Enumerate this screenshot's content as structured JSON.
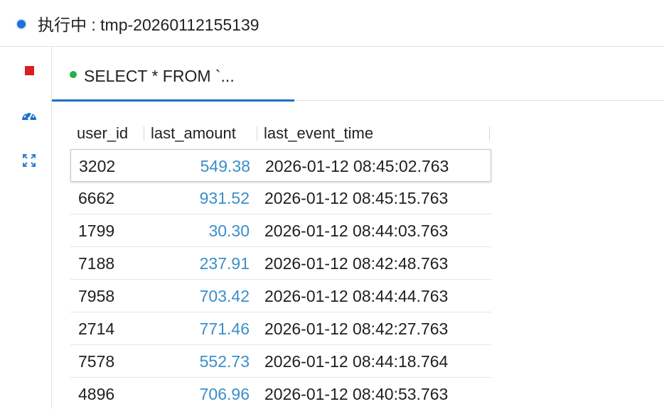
{
  "status": {
    "text": "执行中 : tmp-20260112155139",
    "color": "#1e6fd9"
  },
  "toolbar": {
    "icons": [
      "stop-icon",
      "dashboard-gauge-icon",
      "expand-icon"
    ],
    "stop_color": "#d81e1e",
    "accent": "#1e72c8"
  },
  "tabs": [
    {
      "label": "SELECT * FROM `...",
      "active": true,
      "dot_color": "#22b04b"
    }
  ],
  "table": {
    "columns": [
      "user_id",
      "last_amount",
      "last_event_time"
    ],
    "rows": [
      {
        "user_id": "3202",
        "last_amount": "549.38",
        "last_event_time": "2026-01-12 08:45:02.763"
      },
      {
        "user_id": "6662",
        "last_amount": "931.52",
        "last_event_time": "2026-01-12 08:45:15.763"
      },
      {
        "user_id": "1799",
        "last_amount": "30.30",
        "last_event_time": "2026-01-12 08:44:03.763"
      },
      {
        "user_id": "7188",
        "last_amount": "237.91",
        "last_event_time": "2026-01-12 08:42:48.763"
      },
      {
        "user_id": "7958",
        "last_amount": "703.42",
        "last_event_time": "2026-01-12 08:44:44.763"
      },
      {
        "user_id": "2714",
        "last_amount": "771.46",
        "last_event_time": "2026-01-12 08:42:27.763"
      },
      {
        "user_id": "7578",
        "last_amount": "552.73",
        "last_event_time": "2026-01-12 08:44:18.764"
      },
      {
        "user_id": "4896",
        "last_amount": "706.96",
        "last_event_time": "2026-01-12 08:40:53.763"
      }
    ],
    "number_color": "#3a8fc9"
  }
}
